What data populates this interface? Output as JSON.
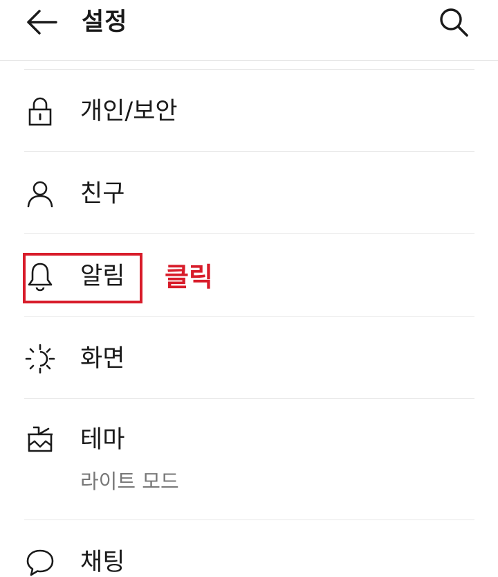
{
  "header": {
    "title": "설정",
    "back_icon": "arrow-left-icon",
    "search_icon": "search-icon"
  },
  "settings": {
    "items": [
      {
        "label": "개인/보안",
        "icon": "lock-icon"
      },
      {
        "label": "친구",
        "icon": "person-icon"
      },
      {
        "label": "알림",
        "icon": "bell-icon"
      },
      {
        "label": "화면",
        "icon": "brightness-icon"
      },
      {
        "label": "테마",
        "sublabel": "라이트 모드",
        "icon": "paint-brush-icon"
      },
      {
        "label": "채팅",
        "icon": "chat-bubble-icon"
      }
    ]
  },
  "annotation": {
    "text": "클릭",
    "color": "#d81c2a"
  }
}
